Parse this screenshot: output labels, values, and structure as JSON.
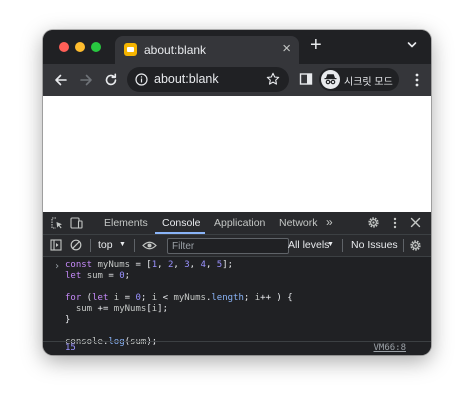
{
  "tab": {
    "title": "about:blank",
    "close": "×"
  },
  "newtab": "+",
  "omnibox": {
    "url": "about:blank"
  },
  "incognito": {
    "label": "시크릿 모드"
  },
  "devtools": {
    "tabs": [
      "Elements",
      "Console",
      "Application",
      "Network"
    ],
    "more_tabs": "»",
    "context": "top",
    "filter_placeholder": "Filter",
    "levels": "All levels",
    "issues": "No Issues"
  },
  "console": {
    "prompt": "›",
    "result": "15",
    "source": "VM66:8"
  }
}
